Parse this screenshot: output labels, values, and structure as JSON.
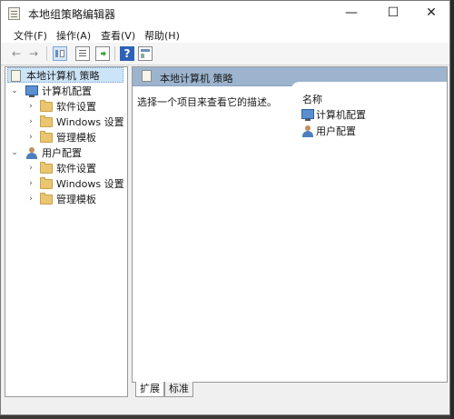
{
  "window": {
    "title": "本地组策略编辑器"
  },
  "title_buttons": {
    "minimize": "—",
    "maximize": "☐",
    "close": "✕"
  },
  "menu": [
    {
      "label": "文件(F)"
    },
    {
      "label": "操作(A)"
    },
    {
      "label": "查看(V)"
    },
    {
      "label": "帮助(H)"
    }
  ],
  "toolbar": {
    "back": "←",
    "forward": "→",
    "help_icon": "?"
  },
  "tree": {
    "root": "本地计算机 策略",
    "computer_config": "计算机配置",
    "computer_children": [
      "软件设置",
      "Windows 设置",
      "管理模板"
    ],
    "user_config": "用户配置",
    "user_children": [
      "软件设置",
      "Windows 设置",
      "管理模板"
    ],
    "expanded_arrow": "⌄",
    "collapsed_arrow": "›"
  },
  "right": {
    "header": "本地计算机 策略",
    "description": "选择一个项目来查看它的描述。",
    "column_name": "名称",
    "items": [
      "计算机配置",
      "用户配置"
    ]
  },
  "tabs": [
    "扩展",
    "标准"
  ]
}
